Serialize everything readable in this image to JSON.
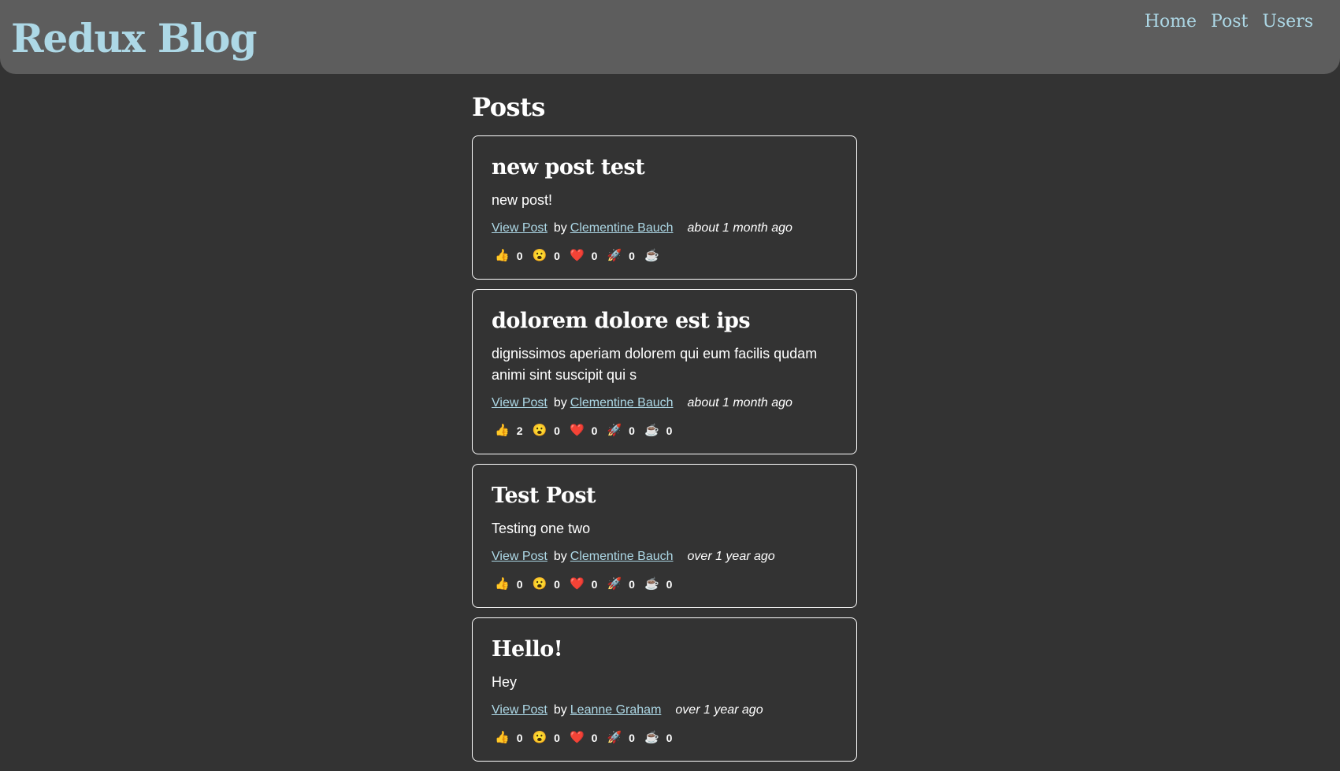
{
  "header": {
    "title": "Redux Blog",
    "nav": [
      "Home",
      "Post",
      "Users"
    ]
  },
  "page": {
    "title": "Posts"
  },
  "reaction_icons": [
    "👍",
    "😮",
    "❤️",
    "🚀",
    "☕"
  ],
  "posts": [
    {
      "title": "new post test",
      "body": "new post!",
      "view_label": "View Post",
      "by": "by",
      "author": "Clementine Bauch",
      "time": "about 1 month ago",
      "reactions": [
        "0",
        "0",
        "0",
        "0",
        ""
      ]
    },
    {
      "title": "dolorem dolore est ips",
      "body": "dignissimos aperiam dolorem qui eum facilis qudam animi sint suscipit qui s",
      "view_label": "View Post",
      "by": "by",
      "author": "Clementine Bauch",
      "time": "about 1 month ago",
      "reactions": [
        "2",
        "0",
        "0",
        "0",
        "0"
      ]
    },
    {
      "title": "Test Post",
      "body": "Testing one two",
      "view_label": "View Post",
      "by": "by",
      "author": "Clementine Bauch",
      "time": "over 1 year ago",
      "reactions": [
        "0",
        "0",
        "0",
        "0",
        "0"
      ]
    },
    {
      "title": "Hello!",
      "body": "Hey",
      "view_label": "View Post",
      "by": "by",
      "author": "Leanne Graham",
      "time": "over 1 year ago",
      "reactions": [
        "0",
        "0",
        "0",
        "0",
        "0"
      ]
    }
  ]
}
